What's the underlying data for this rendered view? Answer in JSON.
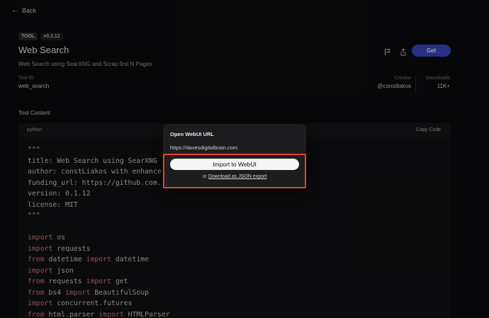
{
  "nav": {
    "back_label": "Back"
  },
  "tool": {
    "badge": "TOOL",
    "version": "v0.1.12",
    "title": "Web Search",
    "description": "Web Search using SearXNG and Scrap first N Pages",
    "id_label": "Tool ID",
    "id_value": "web_search",
    "creator_label": "Creator",
    "creator_value": "@constliakos",
    "downloads_label": "Downloads",
    "downloads_value": "11K+"
  },
  "actions": {
    "get_label": "Get",
    "flag_icon": "flag-icon",
    "share_icon": "share-icon"
  },
  "content": {
    "section_title": "Tool Content",
    "language": "python",
    "copy_label": "Copy Code",
    "lines": [
      [
        {
          "t": "\"\"\"",
          "c": "str"
        }
      ],
      [
        {
          "t": "title: Web Search using SearXNG",
          "c": "str"
        }
      ],
      [
        {
          "t": "author: constLiakos with enhance",
          "c": "str"
        }
      ],
      [
        {
          "t": "funding_url: https://github.com.",
          "c": "str"
        }
      ],
      [
        {
          "t": "version: 0.1.12",
          "c": "str"
        }
      ],
      [
        {
          "t": "license: MIT",
          "c": "str"
        }
      ],
      [
        {
          "t": "\"\"\"",
          "c": "str"
        }
      ],
      [
        {
          "t": "",
          "c": "str"
        }
      ],
      [
        {
          "t": "import",
          "c": "kw"
        },
        {
          "t": " os",
          "c": "str"
        }
      ],
      [
        {
          "t": "import",
          "c": "kw"
        },
        {
          "t": " requests",
          "c": "str"
        }
      ],
      [
        {
          "t": "from",
          "c": "kw"
        },
        {
          "t": " datetime ",
          "c": "str"
        },
        {
          "t": "import",
          "c": "kw"
        },
        {
          "t": " datetime",
          "c": "str"
        }
      ],
      [
        {
          "t": "import",
          "c": "kw"
        },
        {
          "t": " json",
          "c": "str"
        }
      ],
      [
        {
          "t": "from",
          "c": "kw"
        },
        {
          "t": " requests ",
          "c": "str"
        },
        {
          "t": "import",
          "c": "kw"
        },
        {
          "t": " get",
          "c": "str"
        }
      ],
      [
        {
          "t": "from",
          "c": "kw"
        },
        {
          "t": " bs4 ",
          "c": "str"
        },
        {
          "t": "import",
          "c": "kw"
        },
        {
          "t": " BeautifulSoup",
          "c": "str"
        }
      ],
      [
        {
          "t": "import",
          "c": "kw"
        },
        {
          "t": " concurrent.futures",
          "c": "str"
        }
      ],
      [
        {
          "t": "from",
          "c": "kw"
        },
        {
          "t": " html.parser ",
          "c": "str"
        },
        {
          "t": "import",
          "c": "kw"
        },
        {
          "t": " HTMLParser",
          "c": "str"
        }
      ]
    ]
  },
  "popup": {
    "title": "Open WebUI URL",
    "url": "https://davesdigitalbrain.com",
    "import_label": "Import to WebUI",
    "or_label": "or",
    "download_label": "Download as JSON export"
  },
  "colors": {
    "accent": "#3a4bcc",
    "highlight": "#e0452f",
    "keyword": "#e07a7a"
  }
}
